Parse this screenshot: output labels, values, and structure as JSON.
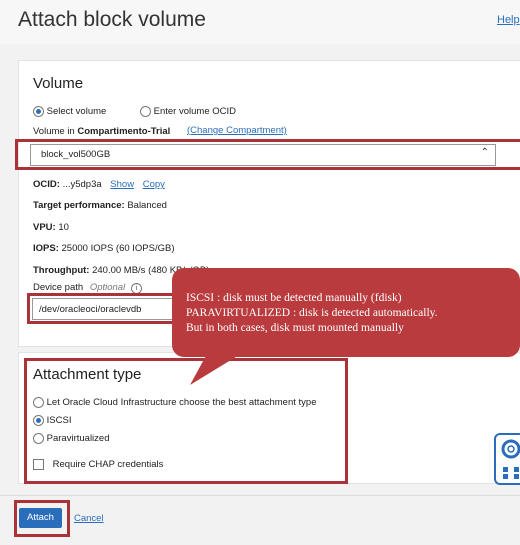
{
  "page": {
    "title": "Attach block volume",
    "help_link": "Help"
  },
  "volume": {
    "section_title": "Volume",
    "radio_select": "Select volume",
    "radio_enter_ocid": "Enter volume OCID",
    "volume_in_label": "Volume in",
    "compartment": "Compartimento-Trial",
    "change_compartment": "(Change Compartment)",
    "selected_volume": "block_vol500GB",
    "ocid_label": "OCID:",
    "ocid_value": "...y5dp3a",
    "show_link": "Show",
    "copy_link": "Copy",
    "target_perf_label": "Target performance:",
    "target_perf_value": "Balanced",
    "vpu_label": "VPU:",
    "vpu_value": "10",
    "iops_label": "IOPS:",
    "iops_value": "25000 IOPS (60 IOPS/GB)",
    "throughput_label": "Throughput:",
    "throughput_value": "240.00 MB/s (480 KB/s/GB)",
    "device_path_label": "Device path",
    "device_path_optional": "Optional",
    "device_path_value": "/dev/oracleoci/oraclevdb"
  },
  "callout": {
    "line1": "ISCSI : disk must be detected manually (fdisk)",
    "line2": "PARAVIRTUALIZED : disk is detected automatically.",
    "line3": "But in both cases, disk must mounted manually"
  },
  "attachment": {
    "section_title": "Attachment type",
    "option_auto": "Let Oracle Cloud Infrastructure choose the best attachment type",
    "option_iscsi": "ISCSI",
    "option_para": "Paravirtualized",
    "chap_label": "Require CHAP credentials"
  },
  "footer": {
    "attach_label": "Attach",
    "cancel_label": "Cancel"
  },
  "colors": {
    "accent": "#2a6ebb",
    "highlight_red": "#a93339",
    "callout_red": "#b93b3e"
  }
}
